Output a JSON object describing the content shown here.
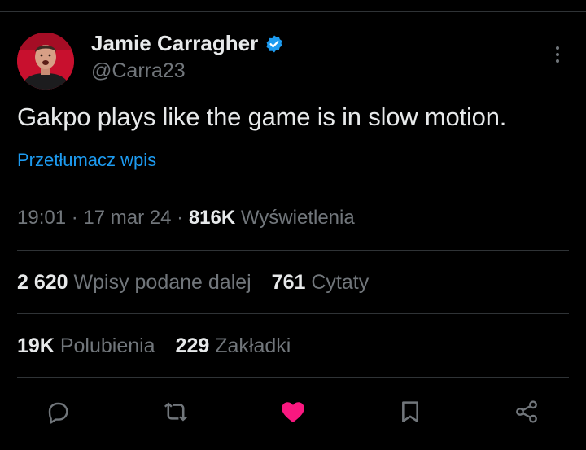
{
  "tweet": {
    "author": {
      "display_name": "Jamie Carragher",
      "handle": "@Carra23",
      "verified": true,
      "avatar_bg": "#c8102e"
    },
    "text": "Gakpo plays like the game is in slow motion.",
    "translate_label": "Przetłumacz wpis",
    "time": "19:01",
    "date": "17 mar 24",
    "views_count": "816K",
    "views_label": "Wyświetlenia",
    "dot": "·"
  },
  "stats": {
    "retweets_count": "2 620",
    "retweets_label": "Wpisy podane dalej",
    "quotes_count": "761",
    "quotes_label": "Cytaty",
    "likes_count": "19K",
    "likes_label": "Polubienia",
    "bookmarks_count": "229",
    "bookmarks_label": "Zakładki"
  },
  "actions": [
    {
      "name": "reply",
      "icon": "reply-icon"
    },
    {
      "name": "retweet",
      "icon": "retweet-icon"
    },
    {
      "name": "like",
      "icon": "heart-icon",
      "active": true
    },
    {
      "name": "bookmark",
      "icon": "bookmark-icon"
    },
    {
      "name": "share",
      "icon": "share-icon"
    }
  ],
  "colors": {
    "background": "#000000",
    "text": "#e7e9ea",
    "secondary": "#71767b",
    "link": "#1d9bf0",
    "like_active": "#f91880",
    "divider": "#2f3336"
  }
}
